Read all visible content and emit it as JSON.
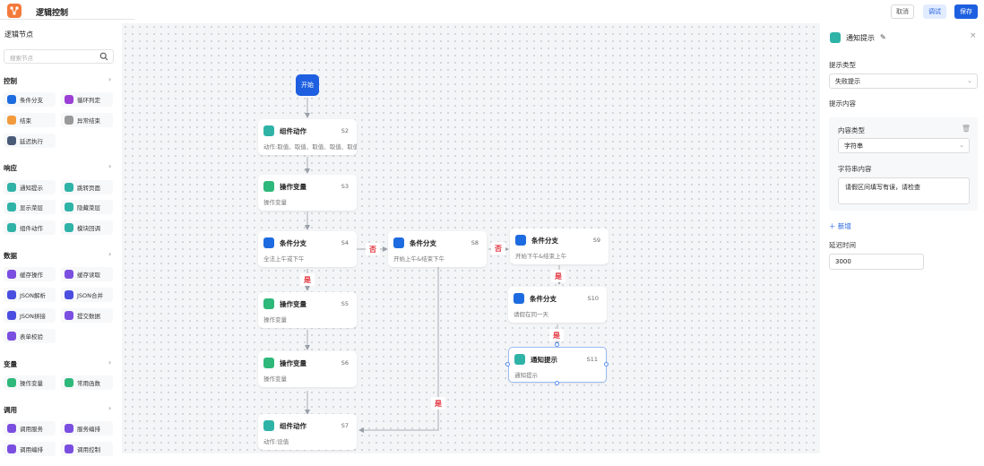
{
  "app": {
    "title": "逻辑控制"
  },
  "toolbar": {
    "cancel_label": "取消",
    "debug_label": "调试",
    "save_label": "保存"
  },
  "sidebar": {
    "title": "逻辑节点",
    "search_placeholder": "搜索节点",
    "sections": [
      {
        "label": "控制",
        "items": [
          "条件分支",
          "循环判定",
          "结束",
          "异常结束",
          "延迟执行"
        ]
      },
      {
        "label": "响应",
        "items": [
          "通知提示",
          "跳转页面",
          "显示菜层",
          "隐藏菜层",
          "组件动作",
          "模块回调"
        ]
      },
      {
        "label": "数据",
        "items": [
          "缓存操作",
          "缓存读取",
          "JSON解析",
          "JSON合并",
          "JSON拼接",
          "提交数据",
          "表单校验"
        ]
      },
      {
        "label": "变量",
        "items": [
          "操作变量",
          "常用函数"
        ]
      },
      {
        "label": "调用",
        "items": [
          "调用服务",
          "服务编排",
          "调用编排",
          "调用控制"
        ]
      }
    ]
  },
  "canvas": {
    "start_label": "开始",
    "nodes": [
      {
        "title": "组件动作",
        "id": "S2",
        "desc": "动作:取值、取值、取值、取值、取值"
      },
      {
        "title": "操作变量",
        "id": "S3",
        "desc": "操作变量"
      },
      {
        "title": "条件分支",
        "id": "S4",
        "desc": "全法上午或下午"
      },
      {
        "title": "条件分支",
        "id": "S8",
        "desc": "开始上午&结束下午"
      },
      {
        "title": "条件分支",
        "id": "S9",
        "desc": "开始下午&结束上午"
      },
      {
        "title": "操作变量",
        "id": "S5",
        "desc": "操作变量"
      },
      {
        "title": "条件分支",
        "id": "S10",
        "desc": "请假在同一天"
      },
      {
        "title": "操作变量",
        "id": "S6",
        "desc": "操作变量"
      },
      {
        "title": "通知提示",
        "id": "S11",
        "desc": "通知提示"
      },
      {
        "title": "组件动作",
        "id": "S7",
        "desc": "动作:设值"
      }
    ],
    "edge_labels": {
      "yes": "是",
      "no": "否"
    }
  },
  "panel": {
    "title": "通知提示",
    "prompt_type_label": "提示类型",
    "prompt_type_value": "失败提示",
    "prompt_content_label": "提示内容",
    "content_type_label": "内容类型",
    "content_type_value": "字符串",
    "string_content_label": "字符串内容",
    "string_content_value": "请假区间填写有误，请检查",
    "add_label": "新增",
    "delay_label": "延迟时间",
    "delay_value": "3000"
  },
  "colors": {
    "primary": "#1d5fe0",
    "condition": "#1d6be0",
    "variable": "#2eb87a",
    "component": "#2fb3a7",
    "notify": "#2fb3a7",
    "yes_no": "#e0323c"
  }
}
